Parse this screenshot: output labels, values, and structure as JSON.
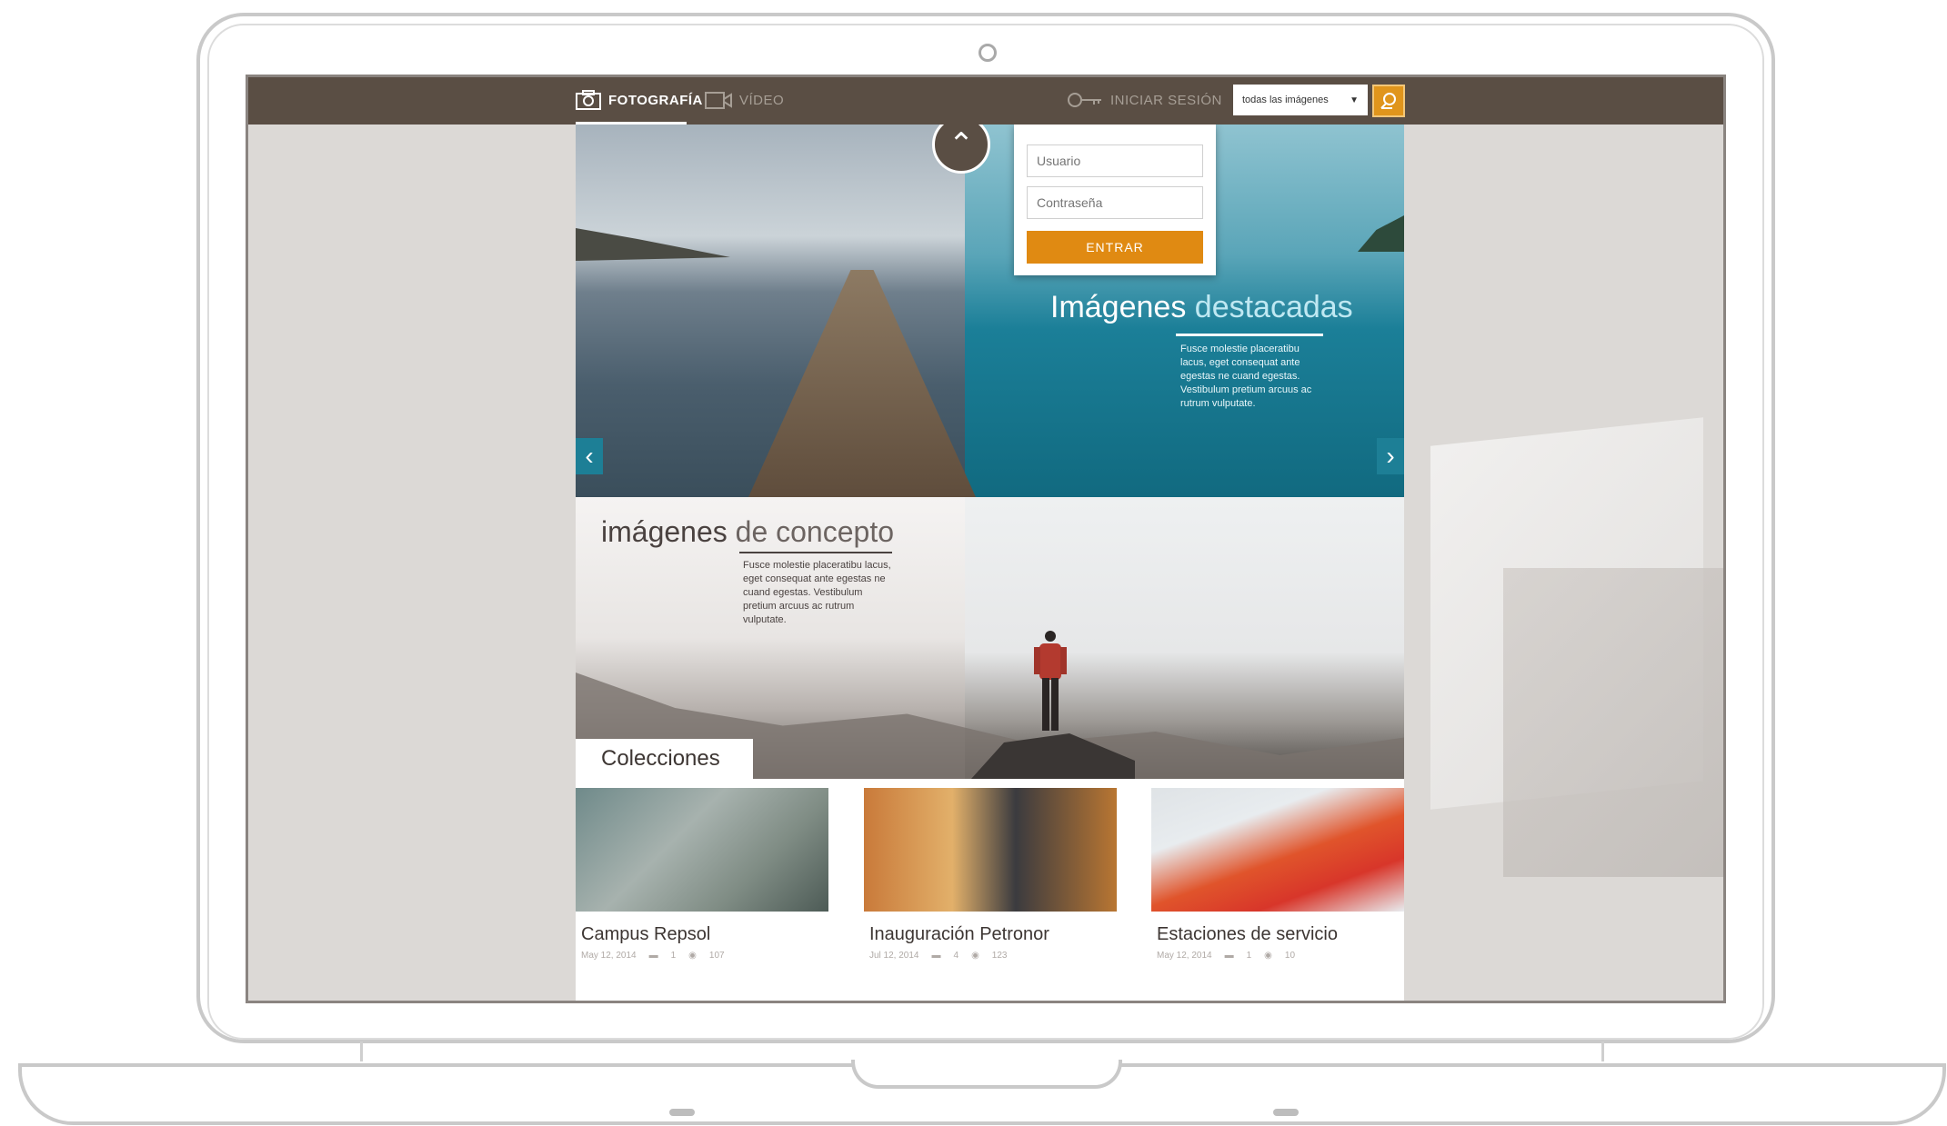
{
  "nav": {
    "photo_label": "FOTOGRAFÍA",
    "video_label": "VÍDEO",
    "login_label": "INICIAR SESIÓN",
    "search_scope": "todas las imágenes"
  },
  "login_form": {
    "user_placeholder": "Usuario",
    "password_placeholder": "Contraseña",
    "submit_label": "ENTRAR"
  },
  "featured": {
    "title_main": "Imágenes",
    "title_accent": "destacadas",
    "text": "Fusce molestie placeratibu lacus, eget consequat ante egestas ne cuand egestas. Vestibulum pretium arcuus ac rutrum vulputate."
  },
  "concept": {
    "title_main": "imágenes",
    "title_light": "de concepto",
    "text": "Fusce molestie placeratibu lacus, eget consequat ante egestas ne cuand egestas. Vestibulum pretium arcuus ac rutrum vulputate."
  },
  "collections": {
    "heading": "Colecciones",
    "items": [
      {
        "title": "Campus Repsol",
        "date": "May 12, 2014",
        "comments": "1",
        "views": "107"
      },
      {
        "title": "Inauguración Petronor",
        "date": "Jul 12, 2014",
        "comments": "4",
        "views": "123"
      },
      {
        "title": "Estaciones de servicio",
        "date": "May 12, 2014",
        "comments": "1",
        "views": "10"
      }
    ]
  },
  "colors": {
    "topbar": "#5a4e44",
    "accent_orange": "#e08a12",
    "teal": "#1d7f96"
  }
}
